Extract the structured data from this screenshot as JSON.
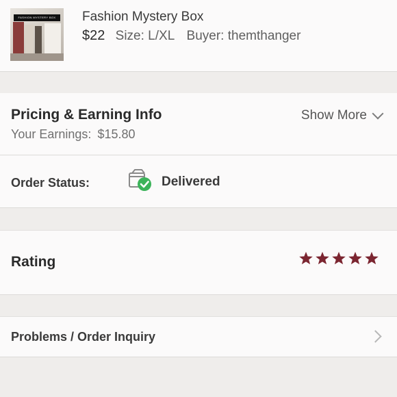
{
  "product": {
    "image_banner_text": "FASHION MYSTERY BOX",
    "title": "Fashion Mystery Box",
    "price": "$22",
    "size": "Size: L/XL",
    "buyer": "Buyer: themthanger"
  },
  "pricing": {
    "title": "Pricing & Earning Info",
    "earnings_label": "Your Earnings:",
    "earnings_value": "$15.80",
    "show_more": "Show More"
  },
  "order_status": {
    "label": "Order Status:",
    "value": "Delivered",
    "icon": "delivered-box-icon"
  },
  "rating": {
    "label": "Rating",
    "stars": 5,
    "max_stars": 5,
    "star_color": "#7b2530"
  },
  "problems": {
    "label": "Problems / Order Inquiry"
  },
  "colors": {
    "background": "#efedeb",
    "card": "#fbfafa",
    "delivered_check": "#3cb35a",
    "accent_star": "#7b2530"
  }
}
